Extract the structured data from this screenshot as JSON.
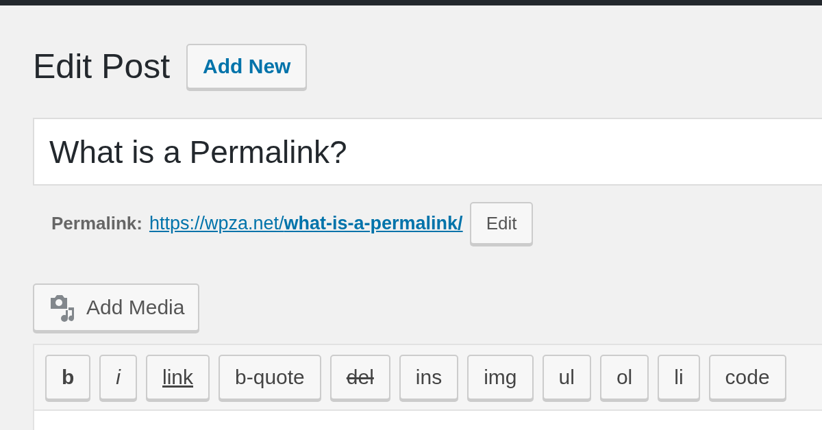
{
  "heading": "Edit Post",
  "add_new_button": "Add New",
  "title_field": {
    "value": "What is a Permalink?"
  },
  "permalink": {
    "label": "Permalink:",
    "url": "https://wpza.net/**what-is-a-permalink/**",
    "edit_button": "Edit"
  },
  "add_media_button": "Add Media",
  "quicktags": [
    {
      "label": "b",
      "kind": "bold"
    },
    {
      "label": "i",
      "kind": "italic"
    },
    {
      "label": "link",
      "kind": "underline"
    },
    {
      "label": "b-quote",
      "kind": "plain"
    },
    {
      "label": "del",
      "kind": "strike"
    },
    {
      "label": "ins",
      "kind": "plain"
    },
    {
      "label": "img",
      "kind": "plain"
    },
    {
      "label": "ul",
      "kind": "plain"
    },
    {
      "label": "ol",
      "kind": "plain"
    },
    {
      "label": "li",
      "kind": "plain"
    },
    {
      "label": "code",
      "kind": "plain"
    }
  ]
}
